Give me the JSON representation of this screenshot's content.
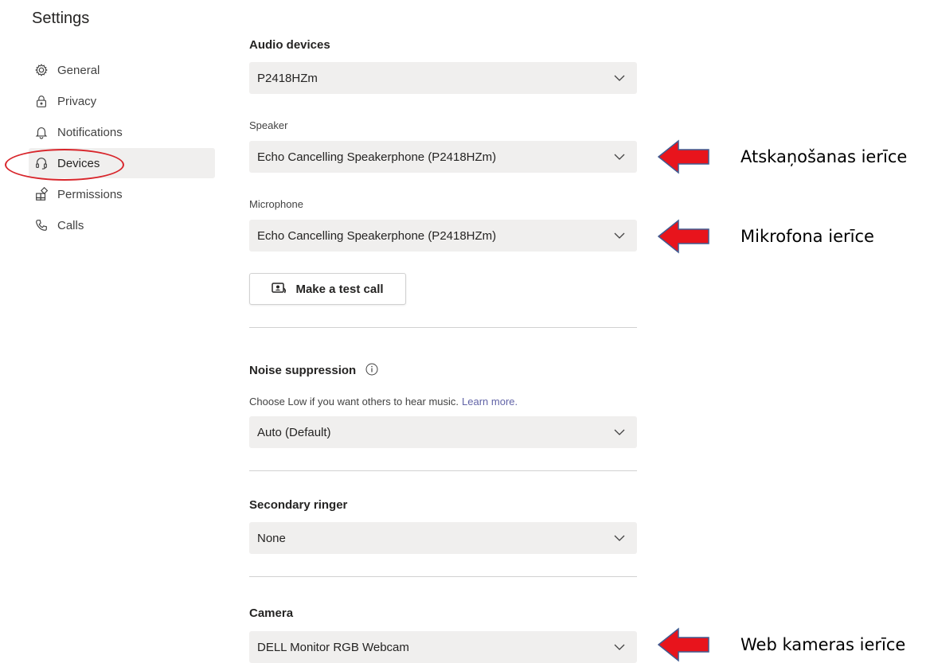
{
  "sidebar": {
    "title": "Settings",
    "items": [
      {
        "label": "General",
        "icon": "gear-icon"
      },
      {
        "label": "Privacy",
        "icon": "lock-icon"
      },
      {
        "label": "Notifications",
        "icon": "bell-icon"
      },
      {
        "label": "Devices",
        "icon": "headset-icon",
        "active": true
      },
      {
        "label": "Permissions",
        "icon": "grid-icon"
      },
      {
        "label": "Calls",
        "icon": "phone-icon"
      }
    ]
  },
  "main": {
    "audio_devices": {
      "heading": "Audio devices",
      "value": "P2418HZm"
    },
    "speaker": {
      "label": "Speaker",
      "value": "Echo Cancelling Speakerphone (P2418HZm)"
    },
    "microphone": {
      "label": "Microphone",
      "value": "Echo Cancelling Speakerphone (P2418HZm)"
    },
    "test_call_label": "Make a test call",
    "noise_suppression": {
      "heading": "Noise suppression",
      "help": "Choose Low if you want others to hear music.",
      "link": "Learn more.",
      "value": "Auto (Default)"
    },
    "secondary_ringer": {
      "heading": "Secondary ringer",
      "value": "None"
    },
    "camera": {
      "heading": "Camera",
      "value": "DELL Monitor RGB Webcam"
    }
  },
  "annotations": {
    "speaker": "Atskaņošanas ierīce",
    "microphone": "Mikrofona ierīce",
    "camera": "Web kameras ierīce"
  },
  "colors": {
    "accent": "#6264a7",
    "annotation_red": "#e8141c",
    "dropdown_bg": "#f0efee"
  }
}
